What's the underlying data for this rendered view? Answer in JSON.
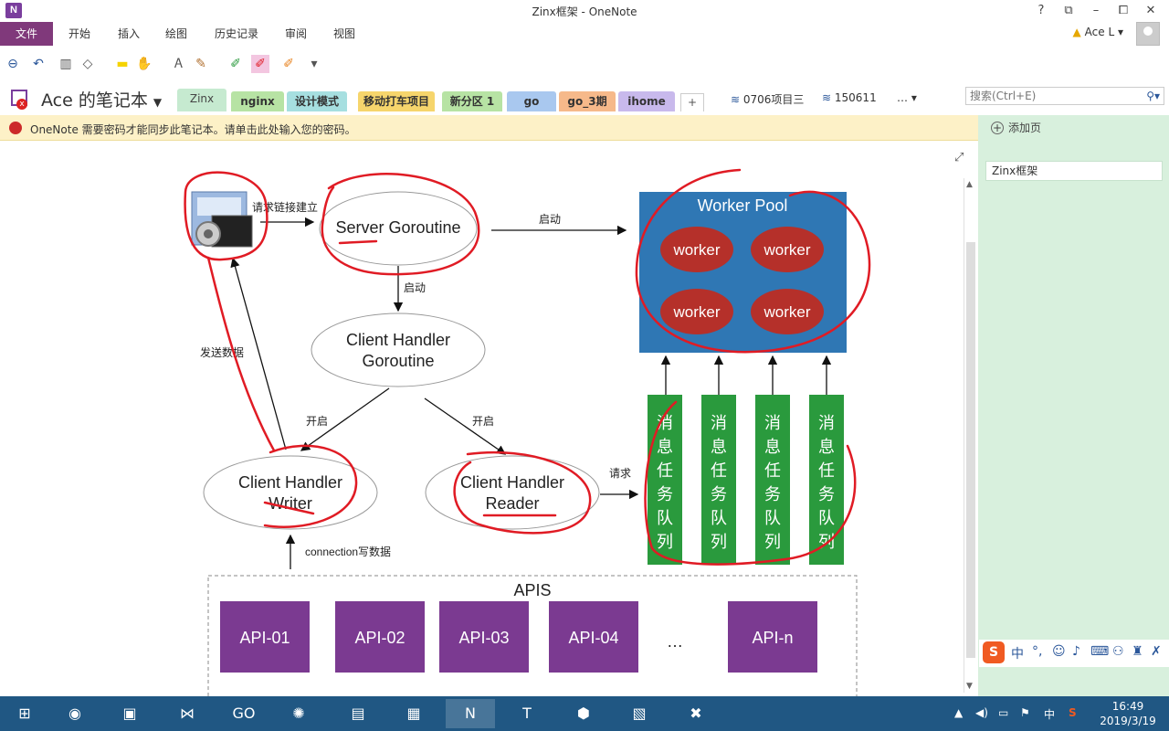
{
  "window": {
    "app_icon": "N",
    "title": "Zinx框架 - OneNote",
    "buttons": [
      "?",
      "⧉",
      "–",
      "⧠",
      "✕"
    ]
  },
  "ribbon": {
    "file_tab": "文件",
    "tabs": [
      "开始",
      "插入",
      "绘图",
      "历史记录",
      "审阅",
      "视图"
    ],
    "user": "Ace L",
    "user_warning_icon": "warning-icon"
  },
  "toolbar": {
    "icons": [
      "back-icon",
      "undo-icon",
      "dock-icon",
      "shapes-icon",
      "highlighter-yellow-icon",
      "lasso-icon",
      "text-mode-icon",
      "pens-icon",
      "pen-green-icon",
      "pen-red-icon",
      "pen-orange-icon",
      "customize-icon"
    ]
  },
  "notebook": {
    "name": "Ace 的笔记本",
    "sections": [
      {
        "label": "Zinx",
        "color": "#c6ead0",
        "active": true
      },
      {
        "label": "nginx",
        "color": "#b7e3a4"
      },
      {
        "label": "设计模式",
        "color": "#a6dfe0"
      },
      {
        "label": "移动打车项目",
        "color": "#f6d56c"
      },
      {
        "label": "新分区 1",
        "color": "#b7e3a4"
      },
      {
        "label": "go",
        "color": "#a9c8ef"
      },
      {
        "label": "go_3期",
        "color": "#f6b98a"
      },
      {
        "label": "ihome",
        "color": "#c8b9ec"
      }
    ],
    "add_section": "+",
    "other_notebooks": [
      "0706项目三",
      "150611"
    ],
    "more": "…",
    "search_placeholder": "搜索(Ctrl+E)"
  },
  "sync_message": "OneNote 需要密码才能同步此笔记本。请单击此处输入您的密码。",
  "pages": {
    "add_page": "添加页",
    "items": [
      "Zinx框架"
    ]
  },
  "diagram": {
    "server_goroutine": "Server Goroutine",
    "worker_pool": {
      "title": "Worker Pool",
      "workers": [
        "worker",
        "worker",
        "worker",
        "worker"
      ]
    },
    "client_handler_goroutine": [
      "Client Handler",
      "Goroutine"
    ],
    "client_handler_writer": [
      "Client Handler",
      "Writer"
    ],
    "client_handler_reader": [
      "Client Handler",
      "Reader"
    ],
    "queues": [
      "消息任务队列",
      "消息任务队列",
      "消息任务队列",
      "消息任务队列"
    ],
    "apis_title": "APIS",
    "apis": [
      "API-01",
      "API-02",
      "API-03",
      "API-04",
      "API-n"
    ],
    "api_ellipsis": "…",
    "labels": {
      "request_connect": "请求链接建立",
      "start_pool": "启动",
      "start_handler": "启动",
      "send_data": "发送数据",
      "open_writer": "开启",
      "open_reader": "开启",
      "request": "请求",
      "conn_write": "connection写数据"
    },
    "colors": {
      "worker_pool": "#2f77b4",
      "worker": "#b5302a",
      "queue": "#2a9a3d",
      "api": "#7b3a91",
      "annotation": "#e01b24"
    }
  },
  "ime": {
    "logo": "S",
    "mode": "中",
    "icons": [
      "punct-icon",
      "emoji-icon",
      "mic-icon",
      "keyboard-icon",
      "user-icon",
      "skin-icon",
      "tools-icon"
    ]
  },
  "taskbar": {
    "apps": [
      "start-icon",
      "chrome-icon",
      "remote-desktop-icon",
      "visual-studio-icon",
      "goland-icon",
      "paint-icon",
      "file-explorer-icon",
      "terminal-icon",
      "onenote-icon",
      "typora-icon",
      "pdf-icon",
      "tool-icon",
      "xmind-icon"
    ],
    "tray_ime": "中",
    "time": "16:49",
    "date": "2019/3/19"
  }
}
